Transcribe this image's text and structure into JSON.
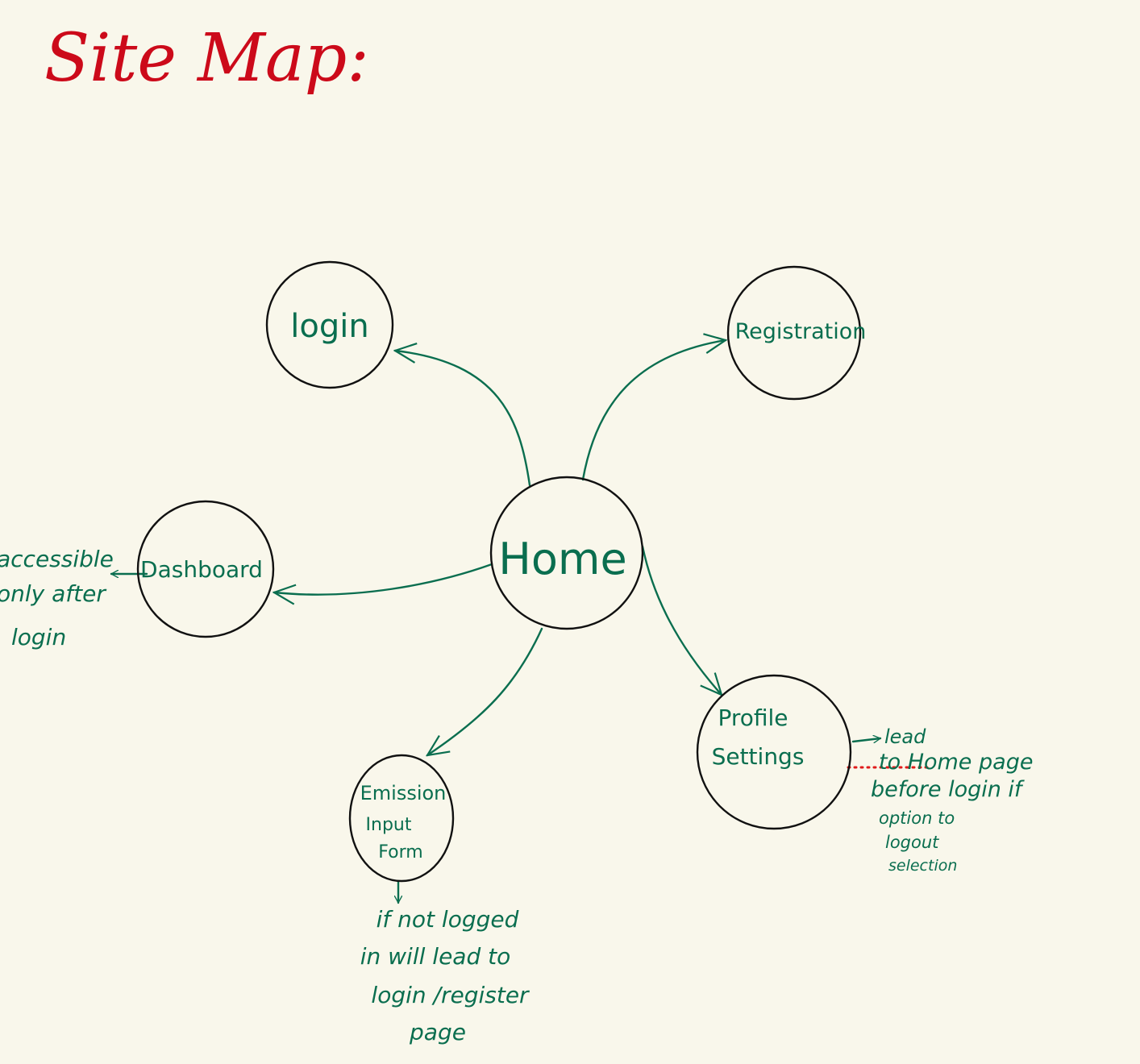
{
  "title": "Site Map:",
  "nodes": {
    "home": "Home",
    "login": "login",
    "registration": "Registration",
    "dashboard": "Dashboard",
    "emission": [
      "Emission",
      "Input",
      "Form"
    ],
    "profile": [
      "Profile",
      "Settings"
    ]
  },
  "notes": {
    "dashboard": [
      "accessible",
      "only after",
      "login"
    ],
    "emission": [
      "if not logged",
      "in will lead to",
      "login /register",
      "page"
    ],
    "profile": [
      "lead",
      "to Home page",
      "before login if",
      "option to",
      "logout",
      "selection"
    ]
  },
  "colors": {
    "background": "#f9f7eb",
    "title": "#cc0a1a",
    "ink": "#0a6e4f",
    "circle": "#111111",
    "dotted": "#e01a1a"
  }
}
